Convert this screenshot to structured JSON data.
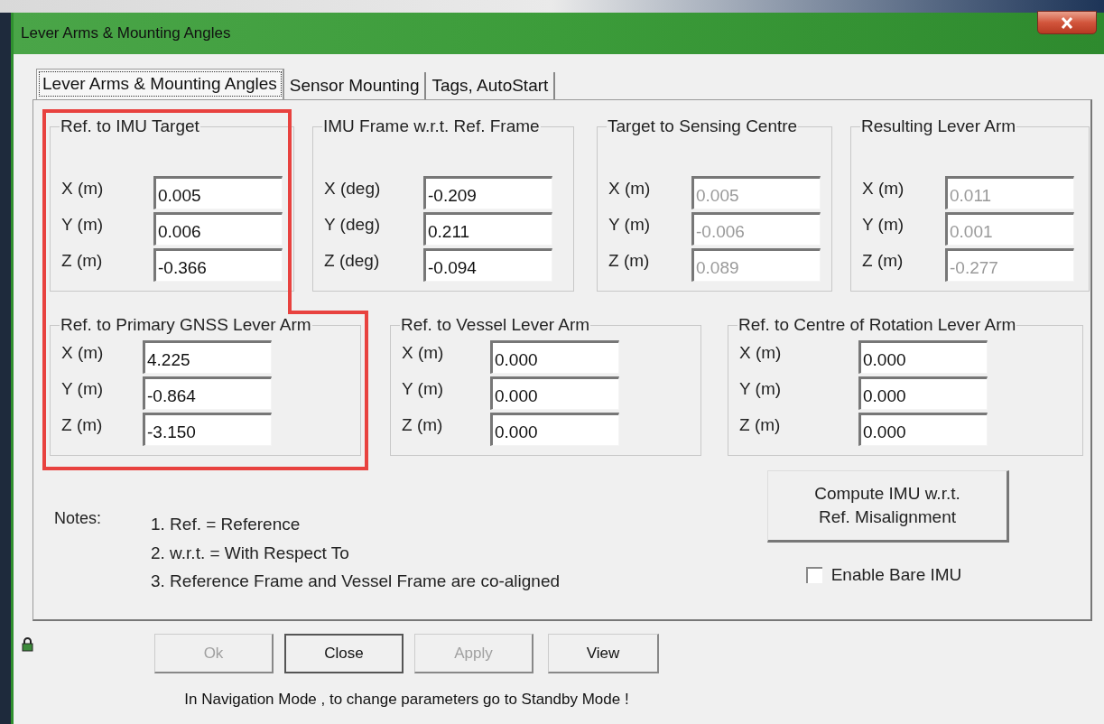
{
  "window": {
    "title": "Lever Arms & Mounting Angles"
  },
  "tabs": [
    {
      "label": "Lever Arms & Mounting Angles",
      "selected": true
    },
    {
      "label": "Sensor Mounting",
      "selected": false
    },
    {
      "label": "Tags, AutoStart",
      "selected": false
    }
  ],
  "groups": [
    {
      "title": "Ref. to IMU Target",
      "highlighted": true,
      "fields": [
        {
          "label": "X (m)",
          "value": "0.005",
          "disabled": false
        },
        {
          "label": "Y (m)",
          "value": "0.006",
          "disabled": false
        },
        {
          "label": "Z (m)",
          "value": "-0.366",
          "disabled": false
        }
      ]
    },
    {
      "title": "IMU Frame w.r.t. Ref. Frame",
      "highlighted": false,
      "fields": [
        {
          "label": "X (deg)",
          "value": "-0.209",
          "disabled": false
        },
        {
          "label": "Y (deg)",
          "value": "0.211",
          "disabled": false
        },
        {
          "label": "Z (deg)",
          "value": "-0.094",
          "disabled": false
        }
      ]
    },
    {
      "title": "Target to Sensing Centre",
      "highlighted": false,
      "fields": [
        {
          "label": "X (m)",
          "value": "0.005",
          "disabled": true
        },
        {
          "label": "Y (m)",
          "value": "-0.006",
          "disabled": true
        },
        {
          "label": "Z (m)",
          "value": "0.089",
          "disabled": true
        }
      ]
    },
    {
      "title": "Resulting Lever Arm",
      "highlighted": false,
      "fields": [
        {
          "label": "X (m)",
          "value": "0.011",
          "disabled": true
        },
        {
          "label": "Y (m)",
          "value": "0.001",
          "disabled": true
        },
        {
          "label": "Z (m)",
          "value": "-0.277",
          "disabled": true
        }
      ]
    },
    {
      "title": "Ref. to Primary GNSS Lever Arm",
      "highlighted": true,
      "fields": [
        {
          "label": "X (m)",
          "value": "4.225",
          "disabled": false
        },
        {
          "label": "Y (m)",
          "value": "-0.864",
          "disabled": false
        },
        {
          "label": "Z (m)",
          "value": "-3.150",
          "disabled": false
        }
      ]
    },
    {
      "title": "Ref. to Vessel Lever Arm",
      "highlighted": false,
      "fields": [
        {
          "label": "X (m)",
          "value": "0.000",
          "disabled": false
        },
        {
          "label": "Y (m)",
          "value": "0.000",
          "disabled": false
        },
        {
          "label": "Z (m)",
          "value": "0.000",
          "disabled": false
        }
      ]
    },
    {
      "title": "Ref. to Centre of Rotation Lever Arm",
      "highlighted": false,
      "fields": [
        {
          "label": "X (m)",
          "value": "0.000",
          "disabled": false
        },
        {
          "label": "Y (m)",
          "value": "0.000",
          "disabled": false
        },
        {
          "label": "Z (m)",
          "value": "0.000",
          "disabled": false
        }
      ]
    }
  ],
  "notes": {
    "label": "Notes:",
    "items": [
      "1. Ref. = Reference",
      "2. w.r.t. = With Respect To",
      "3. Reference Frame and Vessel Frame are co-aligned"
    ]
  },
  "compute_button": {
    "lines": [
      "Compute IMU w.r.t.",
      "Ref. Misalignment"
    ]
  },
  "checkbox": {
    "label": "Enable Bare IMU",
    "checked": false
  },
  "buttons": [
    {
      "label": "Ok",
      "disabled": true,
      "default": false
    },
    {
      "label": "Close",
      "disabled": false,
      "default": true
    },
    {
      "label": "Apply",
      "disabled": true,
      "default": false
    },
    {
      "label": "View",
      "disabled": false,
      "default": false
    }
  ],
  "status_message": "In Navigation Mode , to change parameters go to Standby Mode !"
}
